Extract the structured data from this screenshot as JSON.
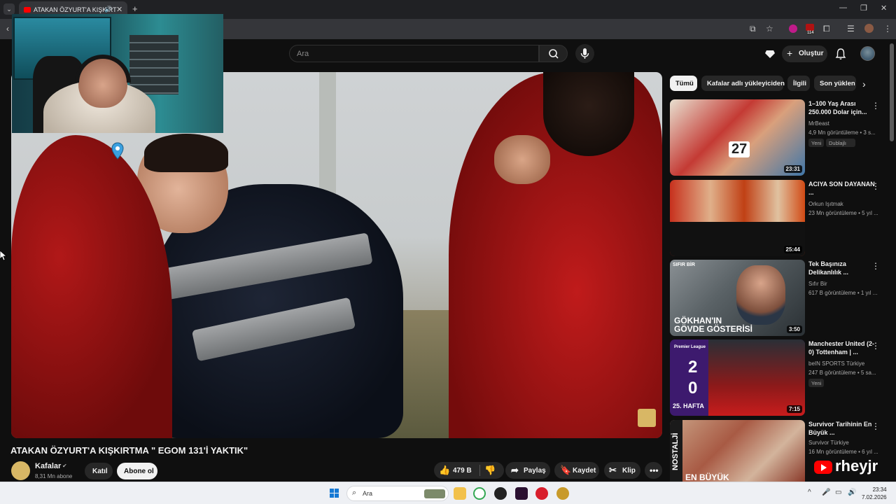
{
  "browser": {
    "tab_title": "ATAKAN ÖZYURT'A KIŞKIRT",
    "ext_badge": "114",
    "icons": [
      "tab-list-icon",
      "speaker-icon",
      "close-icon",
      "plus-icon",
      "minimize-icon",
      "restore-icon",
      "window-close-icon",
      "back-icon",
      "cast-icon",
      "star-icon",
      "extensions-icon",
      "reading-list-icon",
      "menu-icon"
    ]
  },
  "header": {
    "search_placeholder": "Ara",
    "create_label": "Oluştur",
    "icons": [
      "search-icon",
      "mic-icon",
      "gem-icon",
      "bell-icon"
    ]
  },
  "video": {
    "title": "ATAKAN ÖZYURT'A KIŞKIRTMA \" EGOM 131'İ YAKTIK\"",
    "channel": "Kafalar",
    "subscribers": "8,31 Mn abone",
    "join_label": "Katıl",
    "subscribe_label": "Abone ol",
    "likes": "479 B",
    "share_label": "Paylaş",
    "save_label": "Kaydet",
    "clip_label": "Klip"
  },
  "chips": [
    "Tümü",
    "Kafalar adlı yükleyiciden",
    "İlgili",
    "Son yüklen"
  ],
  "recommendations": [
    {
      "title": "1–100 Yaş Arası 250.000 Dolar için...",
      "channel": "MrBeast",
      "meta": "4,9 Mn görüntüleme • 3 s...",
      "duration": "23:31",
      "badges": [
        "Yeni",
        "Dublajlı"
      ]
    },
    {
      "title": "ACIYA SON DAYANAN ...",
      "channel": "Orkun Işıtmak",
      "meta": "23 Mn görüntüleme • 5 yıl ...",
      "duration": "25:44",
      "badges": []
    },
    {
      "title": "Tek Başınıza Delikanlılık ...",
      "channel": "Sıfır Bir",
      "meta": "617 B görüntüleme • 1 yıl ...",
      "duration": "3:50",
      "badges": [],
      "thumb_top": "SIFIR BİR",
      "thumb_line1": "GÖKHAN'IN",
      "thumb_line2": "GÖVDE GÖSTERİSİ"
    },
    {
      "title": "Manchester United (2-0) Tottenham | ...",
      "channel": "beIN SPORTS Türkiye",
      "meta": "247 B görüntüleme • 5 sa...",
      "duration": "7:15",
      "badges": [
        "Yeni"
      ],
      "thumb_league": "Premier League",
      "thumb_score1": "2",
      "thumb_score2": "0",
      "thumb_week": "25. HAFTA"
    },
    {
      "title": "Survivor Tarihinin En Büyük ...",
      "channel": "Survivor Türkiye",
      "meta": "16 Mn görüntüleme • 6 yıl ...",
      "duration": "",
      "badges": [],
      "thumb_side": "NOSTALJİ",
      "thumb_bottom": "EN BÜYÜK"
    }
  ],
  "watermark": "rheyjr",
  "taskbar": {
    "search_placeholder": "Ara",
    "time": "23:34",
    "date": "7.02.2026"
  },
  "colors": {
    "background": "#0f0f0f",
    "accent_red": "#ff0000",
    "chip_active": "#f1f1f1"
  }
}
